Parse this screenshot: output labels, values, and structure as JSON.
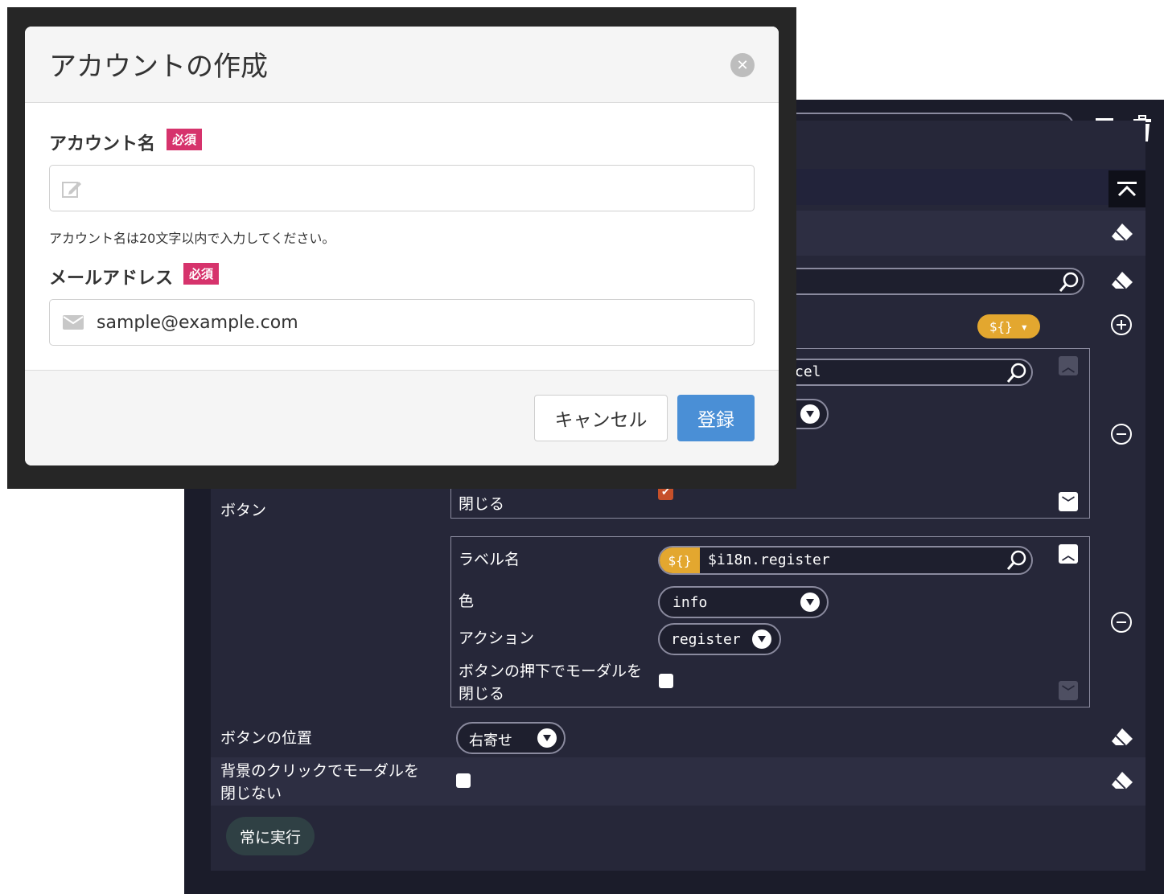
{
  "editor": {
    "toolbar": {
      "copy_icon": "copy-windows-icon",
      "trash_icon": "trash-icon",
      "collapse_icon": "collapse-up-icon"
    },
    "partial_search_value": "cel",
    "template_badge": "${}",
    "buttons_label": "ボタン",
    "button1": {
      "close_label": "閉じる"
    },
    "button2": {
      "label_field": "ラベル名",
      "label_badge": "${}",
      "label_value": "$i18n.register",
      "color_field": "色",
      "color_value": "info",
      "action_field": "アクション",
      "action_value": "register",
      "close_on_press_field_line1": "ボタンの押下でモーダルを",
      "close_on_press_field_line2": "閉じる"
    },
    "position_label": "ボタンの位置",
    "position_value": "右寄せ",
    "backdrop_label_line1": "背景のクリックでモーダルを",
    "backdrop_label_line2": "閉じない",
    "always_run_label": "常に実行"
  },
  "modal": {
    "title": "アカウントの作成",
    "account_label": "アカウント名",
    "required_badge": "必須",
    "account_value": "",
    "account_help": "アカウント名は20文字以内で入力してください。",
    "email_label": "メールアドレス",
    "email_value": "sample@example.com",
    "cancel_label": "キャンセル",
    "submit_label": "登録"
  },
  "colors": {
    "editor_bg": "#1b1c2a",
    "accent_badge": "#e3a72f",
    "primary": "#4a8fd6",
    "required": "#d6336c"
  }
}
